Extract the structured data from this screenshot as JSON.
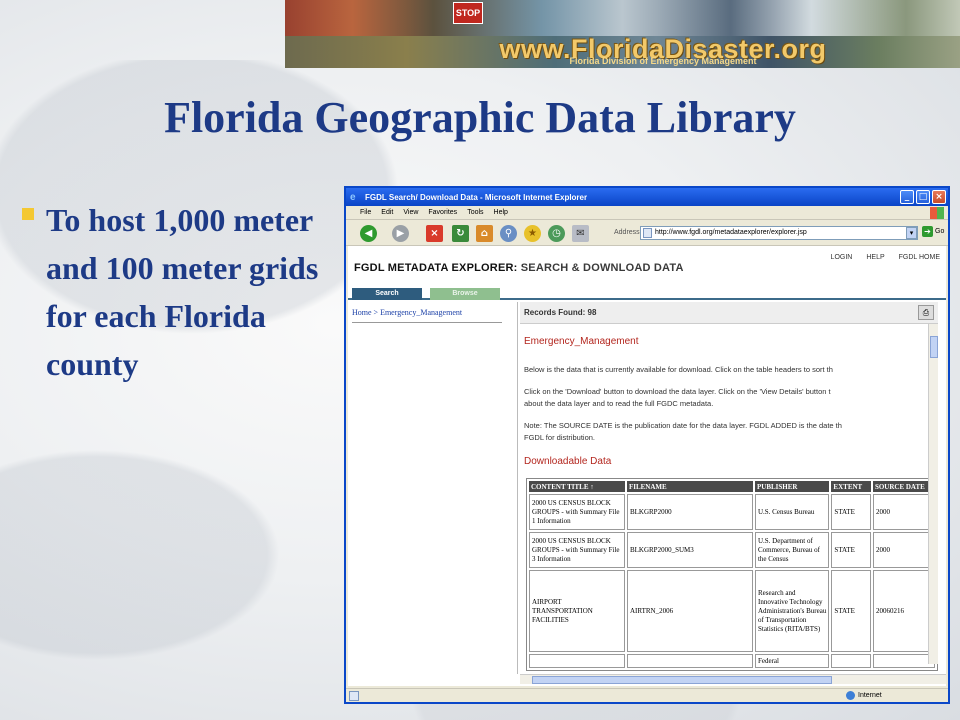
{
  "banner": {
    "stop_sign": "STOP",
    "url_text": "www.FloridaDisaster.org",
    "subtitle": "Florida Division of Emergency Management"
  },
  "slide": {
    "title": "Florida Geographic Data Library",
    "bullet": "To host 1,000 meter and 100 meter grids for each Florida county"
  },
  "ie": {
    "window_title": "FGDL Search/ Download Data - Microsoft Internet Explorer",
    "menu": [
      "File",
      "Edit",
      "View",
      "Favorites",
      "Tools",
      "Help"
    ],
    "address_label": "Address",
    "address_url": "http://www.fgdl.org/metadataexplorer/explorer.jsp",
    "go_label": "Go",
    "status_zone": "Internet"
  },
  "fgdl": {
    "title_bold": "FGDL METADATA EXPLORER:",
    "title_rest": " SEARCH & DOWNLOAD DATA",
    "links": [
      "LOGIN",
      "HELP",
      "FGDL HOME"
    ],
    "tabs": [
      "Search",
      "Browse"
    ],
    "breadcrumb": "Home > Emergency_Management",
    "records_found": "Records Found: 98",
    "section_title": "Emergency_Management",
    "para1": "Below is the data that is currently available for download. Click on the table headers to sort th",
    "para2a": "Click on the 'Download' button to download the data layer. Click on the 'View Details' button t",
    "para2b": "about the data layer and to read the full FGDC metadata.",
    "para3a": "Note: The SOURCE DATE is the publication date for the data layer. FGDL ADDED is the date th",
    "para3b": "FGDL for distribution.",
    "downloadable_title": "Downloadable Data",
    "table": {
      "headers": [
        "CONTENT TITLE ↑",
        "FILENAME",
        "PUBLISHER",
        "EXTENT",
        "SOURCE DATE"
      ],
      "rows": [
        [
          "2000 US CENSUS BLOCK GROUPS - with Summary File 1 Information",
          "BLKGRP2000",
          "U.S. Census Bureau",
          "STATE",
          "2000"
        ],
        [
          "2000 US CENSUS BLOCK GROUPS - with Summary File 3 Information",
          "BLKGRP2000_SUM3",
          "U.S. Department of Commerce, Bureau of the Census",
          "STATE",
          "2000"
        ],
        [
          "AIRPORT TRANSPORTATION FACILITIES",
          "AIRTRN_2006",
          "Research and Innovative Technology Administration's Bureau of Transportation Statistics (RITA/BTS)",
          "STATE",
          "20060216"
        ],
        [
          "",
          "",
          "Federal",
          "",
          ""
        ]
      ]
    }
  }
}
